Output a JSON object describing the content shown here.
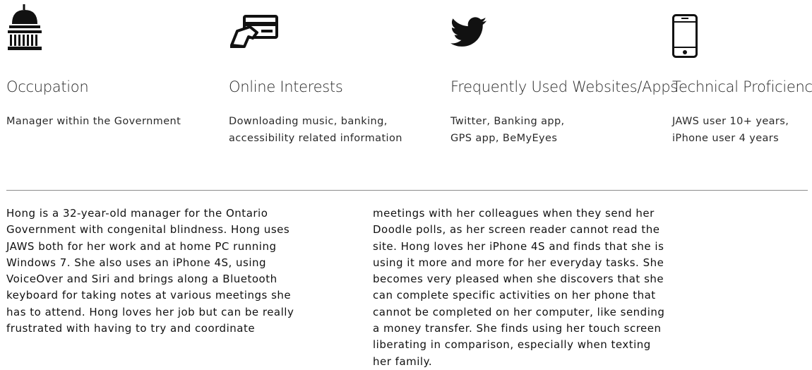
{
  "profile": {
    "columns": [
      {
        "icon": "government-building-icon",
        "title": "Occupation",
        "text": "Manager within the Government"
      },
      {
        "icon": "credit-card-hand-icon",
        "title": "Online Interests",
        "text": "Downloading music, banking,\naccessibility related information"
      },
      {
        "icon": "twitter-bird-icon",
        "title": "Frequently Used Websites/Apps",
        "text": "Twitter, Banking app,\nGPS app, BeMyEyes"
      },
      {
        "icon": "smartphone-icon",
        "title": "Technical Proficiency",
        "text": "JAWS user 10+ years,\niPhone user 4 years"
      }
    ]
  },
  "bio": {
    "column_1": "Hong is a 32-year-old manager for the Ontario\nGovernment with congenital blindness. Hong uses\nJAWS both for her work and at home PC running\nWindows 7. She also uses an iPhone 4S, using\nVoiceOver and Siri and brings along a Bluetooth\nkeyboard for taking notes at various meetings she\nhas to attend. Hong loves her job but can be really\nfrustrated with having to try and coordinate",
    "column_2": "meetings with her colleagues when they send her\nDoodle polls, as her screen reader cannot read the\nsite. Hong loves her iPhone 4S and finds that she is\nusing it more and more for her everyday tasks. She\nbecomes very pleased when she discovers that she\ncan complete specific activities on her phone that\ncannot be completed on her computer, like sending\na money transfer. She finds using her touch screen\nliberating in comparison, especially when texting\nher family."
  }
}
